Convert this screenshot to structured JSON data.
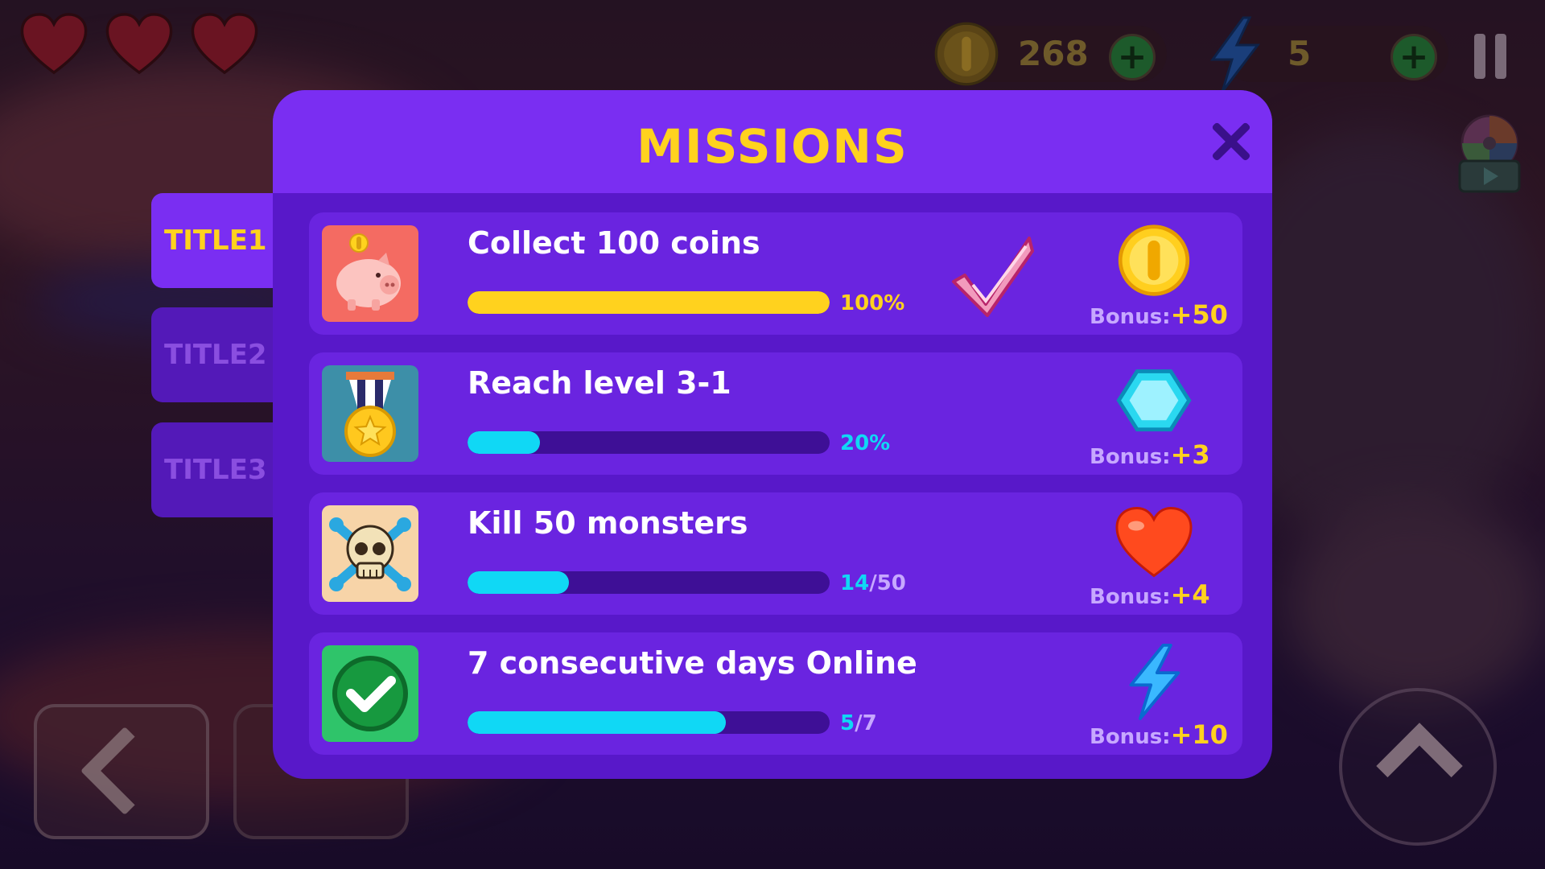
{
  "hud": {
    "coins": "268",
    "energy": "5",
    "add_label": "+"
  },
  "tabs": [
    {
      "label": "TITLE1",
      "active": true
    },
    {
      "label": "TITLE2",
      "active": false
    },
    {
      "label": "TITLE3",
      "active": false
    }
  ],
  "modal": {
    "title": "MISSIONS",
    "close_icon": "close-icon"
  },
  "missions": [
    {
      "title": "Collect 100 coins",
      "progress_text": "100%",
      "progress_fraction": 1.0,
      "bar_color": "#ffd21e",
      "progress_color": "#ffd21e",
      "icon": "piggy-bank-icon",
      "completed": true,
      "bonus_label": "Bonus:",
      "bonus_amount": "+50",
      "reward_icon": "coin-icon"
    },
    {
      "title": "Reach level 3-1",
      "progress_text": "20%",
      "progress_fraction": 0.2,
      "bar_color": "#10d8f5",
      "progress_color": "#10d8f5",
      "icon": "medal-icon",
      "completed": false,
      "bonus_label": "Bonus:",
      "bonus_amount": "+3",
      "reward_icon": "gem-icon"
    },
    {
      "title": "Kill 50 monsters",
      "progress_current": "14",
      "progress_total": "/50",
      "progress_fraction": 0.28,
      "bar_color": "#10d8f5",
      "progress_color": "#10d8f5",
      "icon": "skull-crossbones-icon",
      "completed": false,
      "bonus_label": "Bonus:",
      "bonus_amount": "+4",
      "reward_icon": "heart-icon"
    },
    {
      "title": "7 consecutive days Online",
      "progress_current": "5",
      "progress_total": "/7",
      "progress_fraction": 0.714,
      "bar_color": "#10d8f5",
      "progress_color": "#10d8f5",
      "icon": "check-circle-icon",
      "completed": false,
      "bonus_label": "Bonus:",
      "bonus_amount": "+10",
      "reward_icon": "lightning-icon"
    }
  ],
  "colors": {
    "modal_bg": "#5818c9",
    "header_bg": "#7a2ef2",
    "title_yellow": "#ffd21e",
    "bar_cyan": "#10d8f5",
    "bar_track": "#3e0f96"
  }
}
